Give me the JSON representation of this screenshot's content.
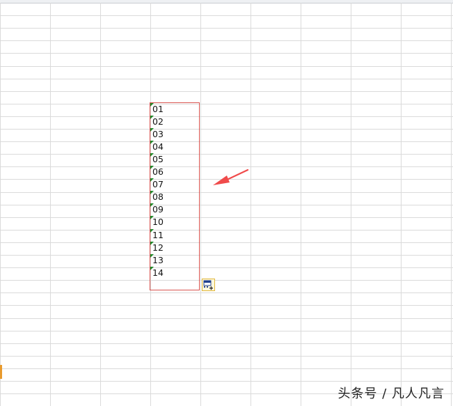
{
  "cells": [
    "01",
    "02",
    "03",
    "04",
    "05",
    "06",
    "07",
    "08",
    "09",
    "10",
    "11",
    "12",
    "13",
    "14"
  ],
  "paste_options_label": "",
  "watermark": "头条号 / 凡人凡言",
  "colors": {
    "gridline": "#dadada",
    "selection_border": "#d9534f",
    "text_indicator": "#1f8a2a",
    "arrow": "#f04b4b",
    "paste_button_border": "#e0b73a"
  },
  "icons": [
    "paste-options-icon",
    "arrow-annotation-icon",
    "number-stored-as-text-indicator-icon"
  ]
}
